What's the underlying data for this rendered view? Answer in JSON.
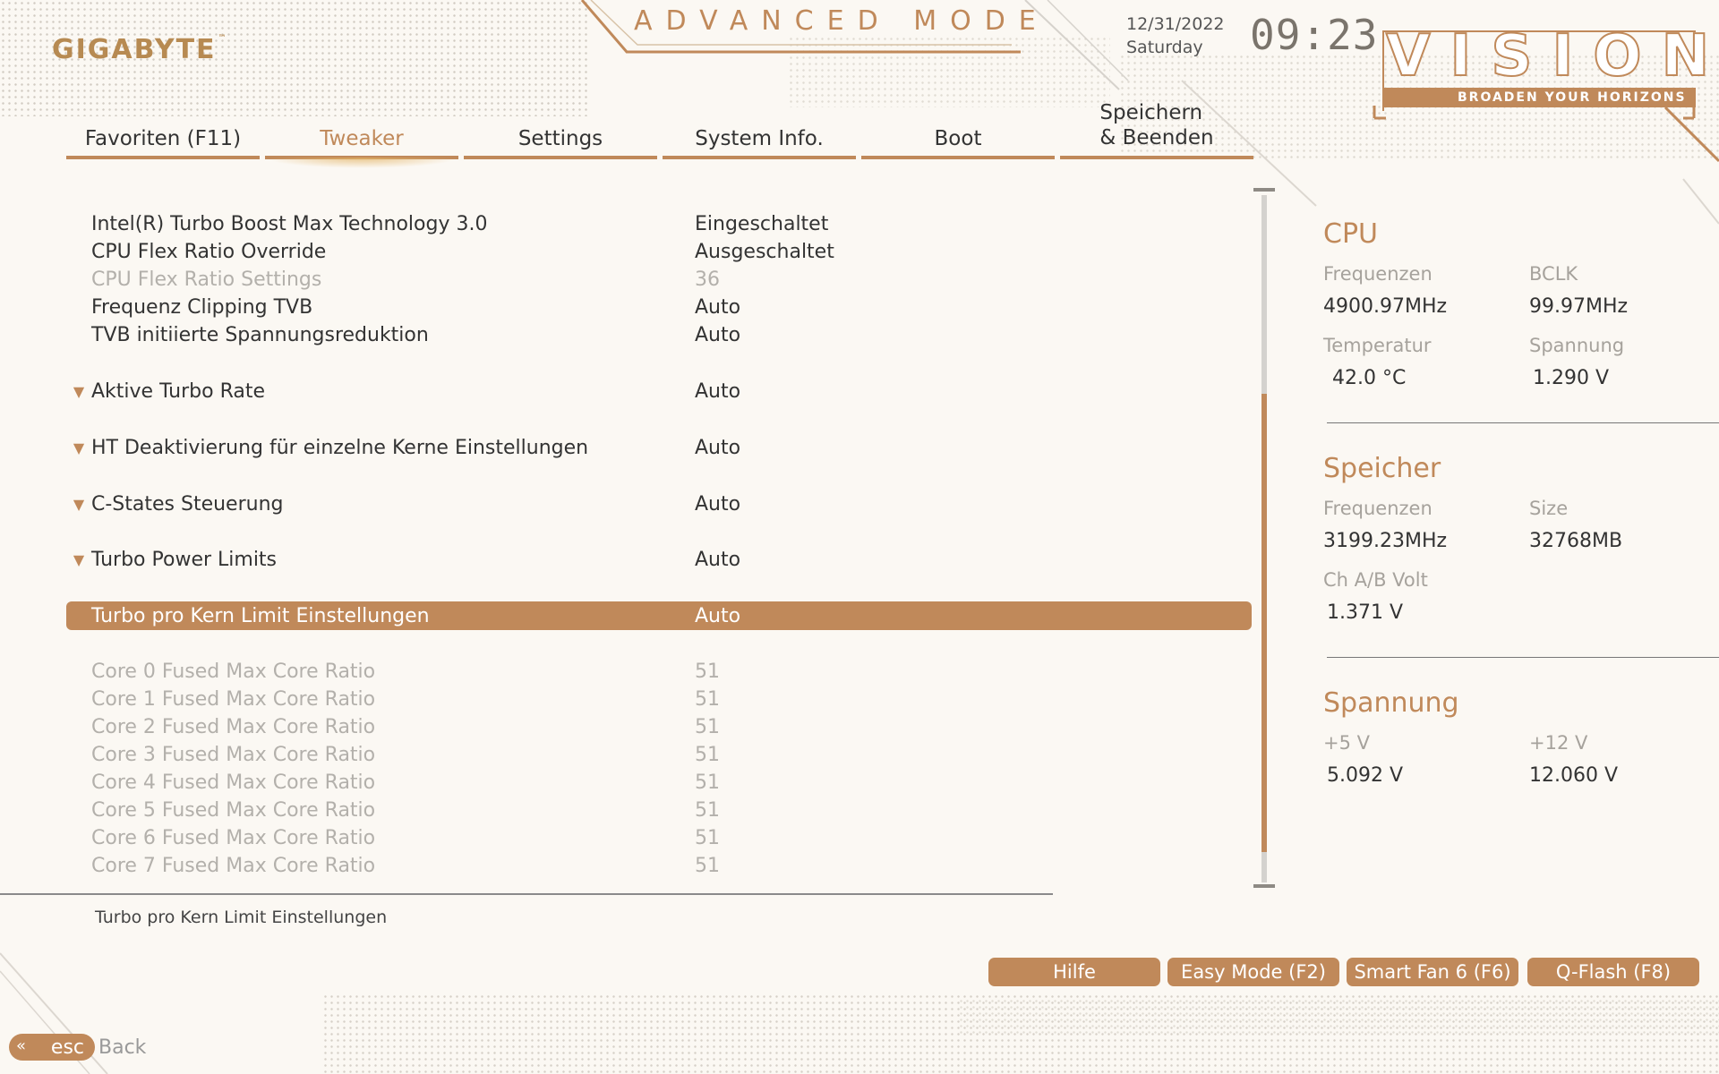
{
  "header": {
    "logo": "GIGABYTE",
    "logo_tm": "™",
    "mode_title": "ADVANCED MODE",
    "date": "12/31/2022",
    "weekday": "Saturday",
    "time": "09:23",
    "brand": "VISION",
    "tagline": "BROADEN YOUR HORIZONS"
  },
  "tabs": [
    {
      "label": "Favoriten (F11)"
    },
    {
      "label": "Tweaker"
    },
    {
      "label": "Settings"
    },
    {
      "label": "System Info."
    },
    {
      "label": "Boot"
    },
    {
      "label_line1": "Speichern",
      "label_line2": "& Beenden"
    }
  ],
  "settings": [
    {
      "label": "Intel(R) Turbo Boost Max Technology 3.0",
      "value": "Eingeschaltet"
    },
    {
      "label": "CPU Flex Ratio Override",
      "value": "Ausgeschaltet"
    },
    {
      "label": "CPU Flex Ratio Settings",
      "value": "36"
    },
    {
      "label": "Frequenz Clipping TVB",
      "value": "Auto"
    },
    {
      "label": "TVB initiierte Spannungsreduktion",
      "value": "Auto"
    },
    {
      "label": "Aktive Turbo Rate",
      "value": "Auto"
    },
    {
      "label": "HT Deaktivierung für einzelne Kerne Einstellungen",
      "value": "Auto"
    },
    {
      "label": "C-States Steuerung",
      "value": "Auto"
    },
    {
      "label": "Turbo Power Limits",
      "value": "Auto"
    },
    {
      "label": "Turbo pro Kern Limit Einstellungen",
      "value": "Auto"
    },
    {
      "label": "Core 0 Fused Max Core Ratio",
      "value": "51"
    },
    {
      "label": "Core 1 Fused Max Core Ratio",
      "value": "51"
    },
    {
      "label": "Core 2 Fused Max Core Ratio",
      "value": "51"
    },
    {
      "label": "Core 3 Fused Max Core Ratio",
      "value": "51"
    },
    {
      "label": "Core 4 Fused Max Core Ratio",
      "value": "51"
    },
    {
      "label": "Core 5 Fused Max Core Ratio",
      "value": "51"
    },
    {
      "label": "Core 6 Fused Max Core Ratio",
      "value": "51"
    },
    {
      "label": "Core 7 Fused Max Core Ratio",
      "value": "51"
    }
  ],
  "help_text": "Turbo pro Kern Limit Einstellungen",
  "side_panel": {
    "cpu": {
      "title": "CPU",
      "freq_label": "Frequenzen",
      "freq_value": "4900.97MHz",
      "bclk_label": "BCLK",
      "bclk_value": "99.97MHz",
      "temp_label": "Temperatur",
      "temp_value": "42.0 °C",
      "volt_label": "Spannung",
      "volt_value": "1.290 V"
    },
    "memory": {
      "title": "Speicher",
      "freq_label": "Frequenzen",
      "freq_value": "3199.23MHz",
      "size_label": "Size",
      "size_value": "32768MB",
      "chvolt_label": "Ch A/B Volt",
      "chvolt_value": "1.371 V"
    },
    "voltage": {
      "title": "Spannung",
      "v5_label": "+5 V",
      "v5_value": "5.092 V",
      "v12_label": "+12 V",
      "v12_value": "12.060 V"
    }
  },
  "buttons": {
    "help": "Hilfe",
    "easy_mode": "Easy Mode (F2)",
    "smart_fan": "Smart Fan 6 (F6)",
    "qflash": "Q-Flash (F8)"
  },
  "back": {
    "key": "esc",
    "label": "Back"
  },
  "colors": {
    "accent": "#c0895a",
    "background": "#fbf8f3",
    "disabled_text": "#b3b0ab"
  }
}
